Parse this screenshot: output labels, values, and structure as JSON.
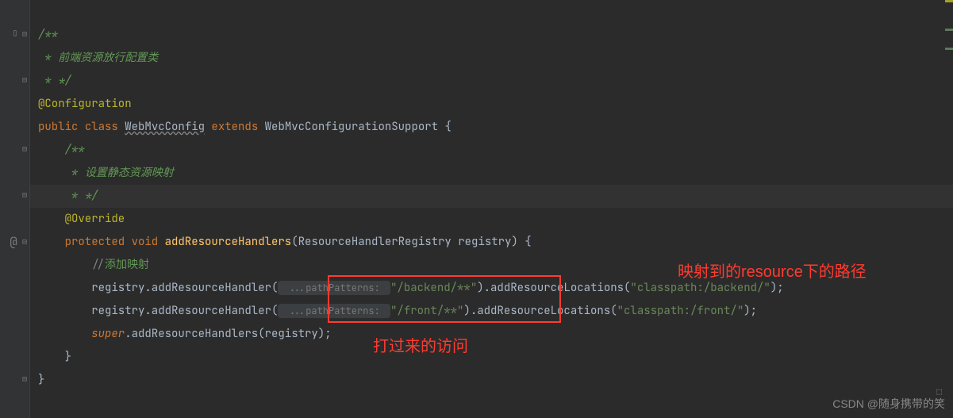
{
  "gutter": {
    "at_symbol": "@"
  },
  "code": {
    "doc1_open": "/**",
    "doc1_l1": " * 前端资源放行配置类",
    "doc1_close": " * */",
    "anno_config": "@Configuration",
    "kw_public": "public ",
    "kw_class": "class ",
    "cls_name": "WebMvcConfig",
    "kw_extends": " extends ",
    "super_cls": "WebMvcConfigurationSupport {",
    "doc2_open": "/**",
    "doc2_l1": " * 设置静态资源映射",
    "doc2_close": " * */",
    "anno_override": "@Override",
    "kw_protected": "protected ",
    "kw_void": "void ",
    "m_name": "addResourceHandlers",
    "m_params": "(ResourceHandlerRegistry registry) {",
    "cmt_slash": "//",
    "cmt_add": "添加映射",
    "l1_pre": "registry.addResourceHandler(",
    "hint_path": " ...pathPatterns: ",
    "str_backend": "\"/backend/**\"",
    "l1_mid": ").addResourceLocations(",
    "str_backend_cp": "\"classpath:/backend/\"",
    "l_end": ");",
    "l2_pre": "registry.addResourceHandler(",
    "str_front": "\"/front/**\"",
    "l2_mid": ").addResourceLocations(",
    "str_front_cp": "\"classpath:/front/\"",
    "super_kw": "super",
    "super_call": ".addResourceHandlers(registry);",
    "brace_close": "}"
  },
  "annotations": {
    "top_right": "映射到的resource下的路径",
    "bottom": "打过来的访问"
  },
  "watermark": "CSDN @随身携带的笑"
}
